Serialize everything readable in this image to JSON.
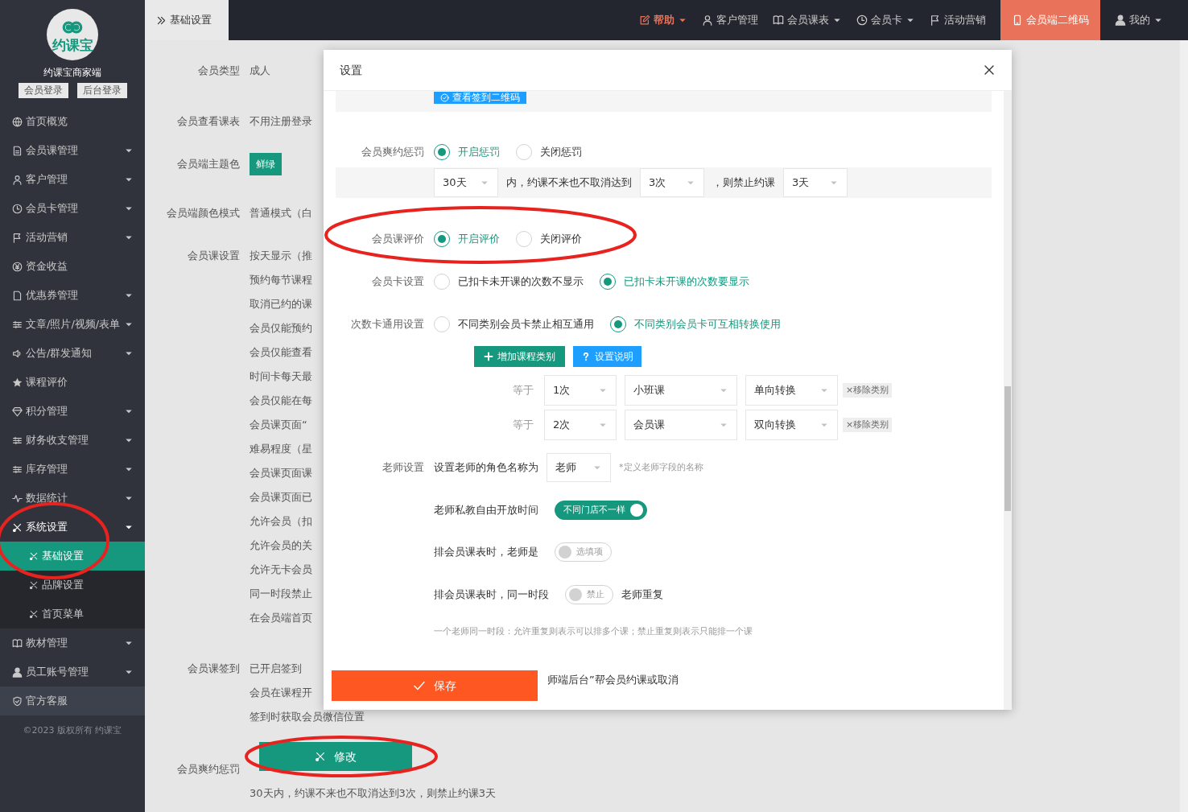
{
  "sidebar": {
    "logo_text": "约课宝",
    "title": "约课宝商家端",
    "login_buttons": [
      "会员登录",
      "后台登录"
    ],
    "items": [
      {
        "label": "首页概览",
        "kind": "link",
        "expanded": false
      },
      {
        "label": "会员课管理",
        "kind": "dropdown",
        "expanded": false
      },
      {
        "label": "客户管理",
        "kind": "dropdown",
        "expanded": false
      },
      {
        "label": "会员卡管理",
        "kind": "dropdown",
        "expanded": false
      },
      {
        "label": "活动营销",
        "kind": "dropdown",
        "expanded": false
      },
      {
        "label": "资金收益",
        "kind": "link",
        "expanded": false
      },
      {
        "label": "优惠券管理",
        "kind": "dropdown",
        "expanded": false
      },
      {
        "label": "文章/照片/视频/表单",
        "kind": "dropdown",
        "expanded": false
      },
      {
        "label": "公告/群发通知",
        "kind": "dropdown",
        "expanded": false
      },
      {
        "label": "课程评价",
        "kind": "link",
        "expanded": false
      },
      {
        "label": "积分管理",
        "kind": "dropdown",
        "expanded": false
      },
      {
        "label": "财务收支管理",
        "kind": "dropdown",
        "expanded": false
      },
      {
        "label": "库存管理",
        "kind": "dropdown",
        "expanded": false
      },
      {
        "label": "数据统计",
        "kind": "dropdown",
        "expanded": false
      },
      {
        "label": "系统设置",
        "kind": "dropdown",
        "expanded": true,
        "children": [
          {
            "label": "基础设置",
            "selected": true
          },
          {
            "label": "品牌设置",
            "selected": false
          },
          {
            "label": "首页菜单",
            "selected": false
          }
        ]
      },
      {
        "label": "教材管理",
        "kind": "dropdown",
        "expanded": false
      },
      {
        "label": "员工账号管理",
        "kind": "dropdown",
        "expanded": false
      },
      {
        "label": "官方客服",
        "kind": "support",
        "expanded": false
      }
    ],
    "footer": "©2023 版权所有 约课宝"
  },
  "topbar": {
    "breadcrumb": "基础设置",
    "menu": [
      {
        "label": "帮助",
        "dropdown": true,
        "emphasized": true,
        "selected": false
      },
      {
        "label": "客户管理",
        "dropdown": false,
        "emphasized": false,
        "selected": false
      },
      {
        "label": "会员课表",
        "dropdown": true,
        "emphasized": false,
        "selected": false
      },
      {
        "label": "会员卡",
        "dropdown": true,
        "emphasized": false,
        "selected": false
      },
      {
        "label": "活动营销",
        "dropdown": false,
        "emphasized": false,
        "selected": false
      },
      {
        "label": "会员端二维码",
        "dropdown": false,
        "emphasized": false,
        "selected": true
      },
      {
        "label": "我的",
        "dropdown": true,
        "emphasized": false,
        "selected": false
      }
    ]
  },
  "settings": [
    {
      "label": "会员类型",
      "values": [
        {
          "kind": "text",
          "text": "成人"
        }
      ]
    },
    {
      "label": "会员查看课表",
      "values": [
        {
          "kind": "text",
          "text": "不用注册登录"
        }
      ]
    },
    {
      "label": "会员端主题色",
      "values": [
        {
          "kind": "badge",
          "text": "鲜绿"
        }
      ]
    },
    {
      "label": "会员端颜色模式",
      "values": [
        {
          "kind": "text",
          "text": "普通模式（白"
        }
      ]
    },
    {
      "label": "会员课设置",
      "values": [
        {
          "kind": "text",
          "text": "按天显示（推"
        },
        {
          "kind": "text",
          "text": "预约每节课程"
        },
        {
          "kind": "text",
          "text": "取消已约的课"
        },
        {
          "kind": "text",
          "text": "会员仅能预约"
        },
        {
          "kind": "text",
          "text": "会员仅能查看"
        },
        {
          "kind": "text",
          "text": "时间卡每天最"
        },
        {
          "kind": "text",
          "text": "会员仅能在每"
        },
        {
          "kind": "text",
          "text": "会员课页面“"
        },
        {
          "kind": "text",
          "text": "难易程度（星"
        },
        {
          "kind": "text",
          "text": "会员课页面课"
        },
        {
          "kind": "text",
          "text": "会员课页面已"
        },
        {
          "kind": "text",
          "text": "允许会员（扣"
        },
        {
          "kind": "text",
          "text": "允许会员的关"
        },
        {
          "kind": "text",
          "text": "允许无卡会员"
        },
        {
          "kind": "text",
          "text": "同一时段禁止"
        },
        {
          "kind": "text",
          "text": "在会员端首页"
        }
      ]
    },
    {
      "label": "会员课签到",
      "values": [
        {
          "kind": "text",
          "text": "已开启签到"
        },
        {
          "kind": "text",
          "text": "会员在课程开"
        },
        {
          "kind": "text",
          "text": "签到时获取会员微信位置"
        }
      ]
    },
    {
      "label": "会员爽约惩罚",
      "values": [
        {
          "kind": "text",
          "text": "30天内，约课不来也不取消达到3次，则禁止约课3天"
        }
      ]
    }
  ],
  "modify_button": "修改",
  "modal": {
    "title": "设置",
    "top_button": "查看签到二维码",
    "save_button": "保存",
    "rows": [
      {
        "kind": "radio",
        "label": "会员爽约惩罚",
        "options": [
          {
            "label": "开启惩罚",
            "selected": true
          },
          {
            "label": "关闭惩罚",
            "selected": false
          }
        ]
      },
      {
        "kind": "inline",
        "shaded": true,
        "parts": [
          {
            "kind": "select",
            "value": "30天"
          },
          {
            "kind": "text",
            "text": "内，约课不来也不取消达到"
          },
          {
            "kind": "select",
            "value": "3次"
          },
          {
            "kind": "text",
            "text": "，则禁止约课"
          },
          {
            "kind": "select",
            "value": "3天"
          }
        ]
      },
      {
        "kind": "radio",
        "label": "会员课评价",
        "options": [
          {
            "label": "开启评价",
            "selected": true
          },
          {
            "label": "关闭评价",
            "selected": false
          }
        ]
      },
      {
        "kind": "radio",
        "label": "会员卡设置",
        "options": [
          {
            "label": "已扣卡未开课的次数不显示",
            "selected": false
          },
          {
            "label": "已扣卡未开课的次数要显示",
            "selected": true
          }
        ]
      },
      {
        "kind": "radio",
        "label": "次数卡通用设置",
        "options": [
          {
            "label": "不同类别会员卡禁止相互通用",
            "selected": false
          },
          {
            "label": "不同类别会员卡可互相转换使用",
            "selected": true
          }
        ]
      },
      {
        "kind": "buttons",
        "buttons": [
          {
            "kind": "add",
            "label": "增加课程类别"
          },
          {
            "kind": "help",
            "label": "设置说明"
          }
        ]
      },
      {
        "kind": "conversion",
        "prefix": "等于",
        "times": "1次",
        "course": "小班课",
        "direction": "单向转换",
        "remove": "×移除类别"
      },
      {
        "kind": "conversion",
        "prefix": "等于",
        "times": "2次",
        "course": "会员课",
        "direction": "双向转换",
        "remove": "×移除类别"
      },
      {
        "kind": "inline",
        "shaded": false,
        "label": "老师设置",
        "parts": [
          {
            "kind": "text",
            "text": "设置老师的角色名称为"
          },
          {
            "kind": "select",
            "value": "老师"
          },
          {
            "kind": "hint",
            "text": "*定义老师字段的名称"
          }
        ]
      },
      {
        "kind": "inline",
        "shaded": false,
        "parts": [
          {
            "kind": "text",
            "text": "老师私教自由开放时间"
          },
          {
            "kind": "toggle",
            "text": "不同门店不一样",
            "on": true
          }
        ]
      },
      {
        "kind": "inline",
        "shaded": false,
        "parts": [
          {
            "kind": "text",
            "text": "排会员课表时，老师是"
          },
          {
            "kind": "toggle",
            "text": "选填项",
            "on": false
          }
        ]
      },
      {
        "kind": "inline",
        "shaded": false,
        "parts": [
          {
            "kind": "text",
            "text": "排会员课表时，同一时段"
          },
          {
            "kind": "toggle",
            "text": "禁止",
            "on": false
          },
          {
            "kind": "text",
            "text": "老师重复"
          }
        ]
      },
      {
        "kind": "inline",
        "shaded": false,
        "parts": [
          {
            "kind": "hint",
            "text": "一个老师同一时段：允许重复则表示可以排多个课；禁止重复则表示只能排一个课"
          }
        ]
      },
      {
        "kind": "covered",
        "text": "师端后台”帮会员约课或取消"
      }
    ]
  }
}
